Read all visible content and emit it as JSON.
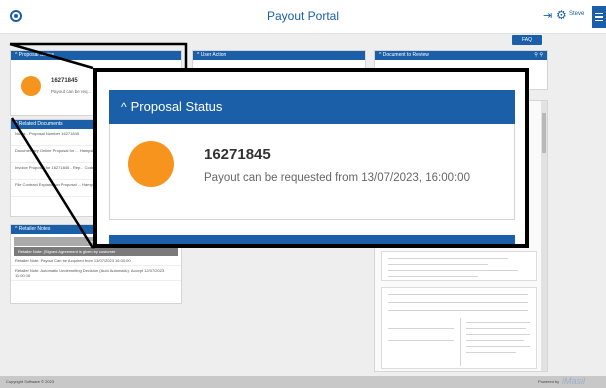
{
  "header": {
    "title": "Payout Portal",
    "user_name": "Steve"
  },
  "toolbar": {
    "faq_label": "FAQ"
  },
  "panels": {
    "proposal_status": {
      "title": "Proposal Status",
      "number": "16271845",
      "status_text": "Payout can be req..."
    },
    "user_action": {
      "title": "User Action"
    },
    "document_review": {
      "title": "Document to Review"
    },
    "related_documents": {
      "title": "Related Documents",
      "items": [
        "Notes - Proposal Number 16271845",
        "Documentary Online Proposal for ... Hampshire Retailer Code 20554",
        "Invoice Proposal for 16271845 - Rep... Code 20554",
        "File Contract Explanation Proposal ... Hampshire Retailer Code 20554"
      ]
    },
    "retailer_notes": {
      "title": "Retailer Notes",
      "new_note_label": "New Note",
      "highlight_note": "Retailer Note: (Signed Agreement is given by customer",
      "notes": [
        "Retailer Note: Payout Can be Acquired from 13/07/2023 16:00:00",
        "Retailer Note: Automatic Underwriting Decision (Auto Automatic): Accept 12/07/2023 11:00:16"
      ]
    }
  },
  "zoom": {
    "title": "Proposal Status",
    "number": "16271845",
    "status_text": "Payout can be requested from 13/07/2023, 16:00:00"
  },
  "footer": {
    "copyright": "Copyright Software © 2023",
    "powered_by": "Powered by",
    "brand": "iMasil"
  },
  "colors": {
    "brand_blue": "#1a5fa8",
    "status_orange": "#f7941d"
  }
}
